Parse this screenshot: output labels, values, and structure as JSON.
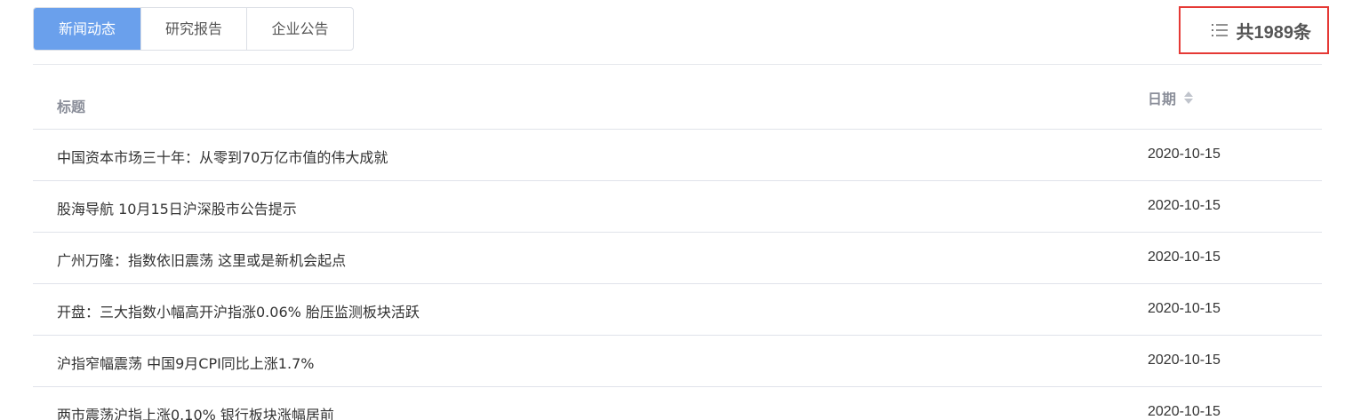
{
  "tabs": [
    {
      "label": "新闻动态",
      "active": true
    },
    {
      "label": "研究报告",
      "active": false
    },
    {
      "label": "企业公告",
      "active": false
    }
  ],
  "total": {
    "icon": "list-icon",
    "label": "共1989条",
    "highlight_color": "#e53935"
  },
  "table": {
    "headers": {
      "title": "标题",
      "date": "日期",
      "date_sort_icon": "sort-icon"
    },
    "rows": [
      {
        "title": "中国资本市场三十年：从零到70万亿市值的伟大成就",
        "date": "2020-10-15"
      },
      {
        "title": "股海导航 10月15日沪深股市公告提示",
        "date": "2020-10-15"
      },
      {
        "title": "广州万隆：指数依旧震荡 这里或是新机会起点",
        "date": "2020-10-15"
      },
      {
        "title": "开盘：三大指数小幅高开沪指涨0.06% 胎压监测板块活跃",
        "date": "2020-10-15"
      },
      {
        "title": "沪指窄幅震荡 中国9月CPI同比上涨1.7%",
        "date": "2020-10-15"
      },
      {
        "title": "两市震荡沪指上涨0.10% 银行板块涨幅居前",
        "date": "2020-10-15"
      }
    ]
  },
  "colors": {
    "active_tab": "#6aa0ec",
    "border": "#dcdfe6",
    "header_text": "#8a8e99"
  }
}
